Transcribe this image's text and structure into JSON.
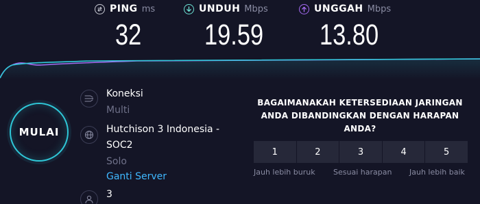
{
  "metrics": {
    "ping": {
      "label": "PING",
      "unit": "ms",
      "value": "32",
      "icon": "ping-icon",
      "color": "#c9cad4"
    },
    "download": {
      "label": "UNDUH",
      "unit": "Mbps",
      "value": "19.59",
      "icon": "download-arrow-icon",
      "color": "#6de3d5"
    },
    "upload": {
      "label": "UNGGAH",
      "unit": "Mbps",
      "value": "13.80",
      "icon": "upload-arrow-icon",
      "color": "#a56bf2"
    }
  },
  "go_button": {
    "label": "MULAI",
    "color": "#2fc8d8"
  },
  "connections": {
    "title": "Koneksi",
    "value": "Multi",
    "icon": "connections-icon"
  },
  "server": {
    "name_line1": "Hutchison 3 Indonesia -",
    "name_line2": "SOC2",
    "location": "Solo",
    "change_link": "Ganti Server",
    "icon": "globe-icon",
    "link_color": "#3fb8ff"
  },
  "user": {
    "value": "3",
    "icon": "user-icon"
  },
  "survey": {
    "question": "BAGAIMANAKAH KETERSEDIAAN JARINGAN ANDA DIBANDINGKAN DENGAN HARAPAN ANDA?",
    "options": [
      "1",
      "2",
      "3",
      "4",
      "5"
    ],
    "caption_worse": "Jauh lebih buruk",
    "caption_expected": "Sesuai harapan",
    "caption_better": "Jauh lebih baik"
  },
  "colors": {
    "background": "#141526",
    "download_line": "#2fc8d8",
    "upload_line": "#a56bf2"
  }
}
